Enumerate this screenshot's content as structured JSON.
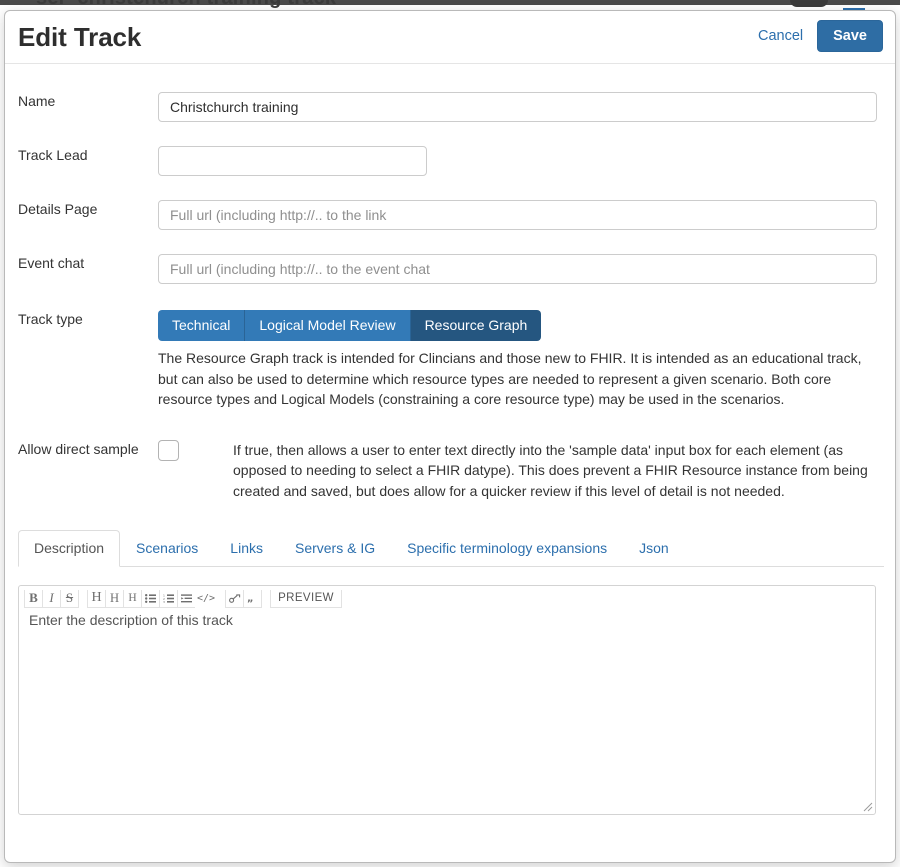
{
  "backdrop": {
    "heading": "ser 'christchurch training track'"
  },
  "modal": {
    "title": "Edit Track",
    "cancel_label": "Cancel",
    "save_label": "Save",
    "accent_color": "#2e6da4",
    "link_color": "#2c6fad"
  },
  "form": {
    "name": {
      "label": "Name",
      "value": "Christchurch training",
      "placeholder": ""
    },
    "track_lead": {
      "label": "Track Lead",
      "value": "",
      "placeholder": ""
    },
    "details_page": {
      "label": "Details Page",
      "value": "",
      "placeholder": "Full url (including http://.. to the link"
    },
    "event_chat": {
      "label": "Event chat",
      "value": "",
      "placeholder": "Full url (including http://.. to the event chat"
    },
    "track_type": {
      "label": "Track type",
      "options": [
        {
          "label": "Technical",
          "active": false
        },
        {
          "label": "Logical Model Review",
          "active": false
        },
        {
          "label": "Resource Graph",
          "active": true
        }
      ],
      "selected": "Resource Graph",
      "description": "The Resource Graph track is intended for Clincians and those new to FHIR. It is intended as an educational track, but can also be used to determine which resource types are needed to represent a given scenario. Both core resource types and Logical Models (constraining a core resource type) may be used in the scenarios.",
      "active_color": "#255680",
      "inactive_color": "#337ab7"
    },
    "allow_direct_sample": {
      "label": "Allow direct sample",
      "checked": false,
      "description": "If true, then allows a user to enter text directly into the 'sample data' input box for each element (as opposed to needing to select a FHIR datype). This does prevent a FHIR Resource instance from being created and saved, but does allow for a quicker review if this level of detail is not needed."
    }
  },
  "tabs": [
    {
      "label": "Description",
      "active": true
    },
    {
      "label": "Scenarios",
      "active": false
    },
    {
      "label": "Links",
      "active": false
    },
    {
      "label": "Servers & IG",
      "active": false
    },
    {
      "label": "Specific terminology expansions",
      "active": false
    },
    {
      "label": "Json",
      "active": false
    }
  ],
  "editor": {
    "toolbar": [
      {
        "name": "bold-icon",
        "glyph": "B",
        "style": "bold"
      },
      {
        "name": "italic-icon",
        "glyph": "I",
        "style": "italic"
      },
      {
        "name": "strikethrough-icon",
        "glyph": "S",
        "style": "strike"
      },
      {
        "name": "heading-1-icon",
        "glyph": "H",
        "style": "h1"
      },
      {
        "name": "heading-2-icon",
        "glyph": "H",
        "style": "h2"
      },
      {
        "name": "heading-3-icon",
        "glyph": "H",
        "style": "h3"
      },
      {
        "name": "unordered-list-icon",
        "glyph": "☰",
        "style": "sym"
      },
      {
        "name": "ordered-list-icon",
        "glyph": "☰",
        "style": "sym"
      },
      {
        "name": "indent-icon",
        "glyph": "☰",
        "style": "sym"
      },
      {
        "name": "code-icon",
        "glyph": "</>",
        "style": "code"
      },
      {
        "name": "link-icon",
        "glyph": "🔗",
        "style": "sym"
      },
      {
        "name": "blockquote-icon",
        "glyph": "”",
        "style": "sym"
      },
      {
        "name": "preview-button",
        "glyph": "PREVIEW",
        "style": "preview"
      }
    ],
    "placeholder": "Enter the description of this track",
    "value": ""
  }
}
